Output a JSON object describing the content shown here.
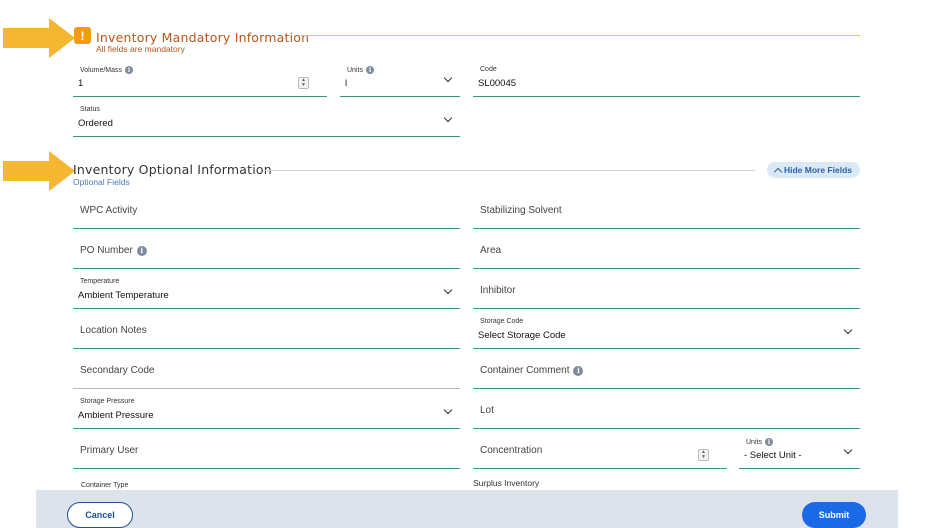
{
  "mandatory": {
    "title": "Inventory Mandatory Information",
    "subtitle": "All fields are mandatory",
    "fields": {
      "volume_mass": {
        "label": "Volume/Mass",
        "value": "1"
      },
      "units": {
        "label": "Units",
        "value": "l"
      },
      "code": {
        "label": "Code",
        "value": "SL00045"
      },
      "status": {
        "label": "Status",
        "value": "Ordered"
      }
    }
  },
  "optional": {
    "title": "Inventory Optional Information",
    "subtitle": "Optional Fields",
    "hide_button": "Hide More Fields",
    "fields": {
      "wpc_activity": "WPC Activity",
      "stabilizing_solvent": "Stabilizing Solvent",
      "po_number": "PO Number",
      "area": "Area",
      "temperature": {
        "label": "Temperature",
        "value": "Ambient Temperature"
      },
      "inhibitor": "Inhibitor",
      "location_notes": "Location Notes",
      "storage_code": {
        "label": "Storage Code",
        "value": "Select Storage Code"
      },
      "secondary_code": "Secondary Code",
      "container_comment": "Container Comment",
      "storage_pressure": {
        "label": "Storage Pressure",
        "value": "Ambient Pressure"
      },
      "lot": "Lot",
      "primary_user": "Primary User",
      "concentration": "Concentration",
      "conc_units": {
        "label": "Units",
        "value": "- Select Unit -"
      },
      "container_type": "Container Type",
      "surplus_inventory": "Surplus Inventory"
    }
  },
  "footer": {
    "cancel": "Cancel",
    "submit": "Submit"
  },
  "colors": {
    "arrow": "#f5b731",
    "mandatory_accent": "#b8541c",
    "field_underline": "#3f8f7e",
    "primary_button": "#1a6ae6"
  }
}
